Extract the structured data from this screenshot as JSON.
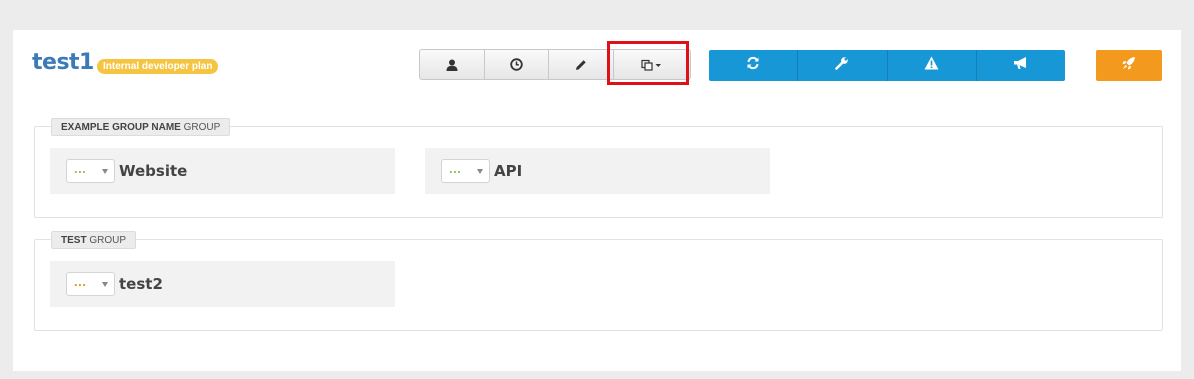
{
  "header": {
    "title": "test1",
    "plan_badge": "Internal developer plan"
  },
  "toolbar": {
    "gray_buttons": [
      {
        "icon": "user-icon"
      },
      {
        "icon": "clock-icon"
      },
      {
        "icon": "pencil-icon"
      },
      {
        "icon": "copy-dropdown-icon"
      }
    ],
    "blue_buttons": [
      {
        "icon": "refresh-icon"
      },
      {
        "icon": "wrench-icon"
      },
      {
        "icon": "warning-icon"
      },
      {
        "icon": "megaphone-icon"
      }
    ],
    "orange_button": {
      "icon": "rocket-icon"
    },
    "colors": {
      "blue": "#1797d6",
      "orange": "#f39a1e",
      "highlight": "#e0101a"
    }
  },
  "groups": [
    {
      "name_bold": "EXAMPLE GROUP NAME",
      "name_suffix": "GROUP",
      "apps": [
        {
          "select_text": "...",
          "status_color": "green",
          "name": "Website"
        },
        {
          "select_text": "...",
          "status_color": "green",
          "name": "API"
        }
      ]
    },
    {
      "name_bold": "TEST",
      "name_suffix": "GROUP",
      "apps": [
        {
          "select_text": "...",
          "status_color": "orange",
          "name": "test2"
        }
      ]
    }
  ]
}
